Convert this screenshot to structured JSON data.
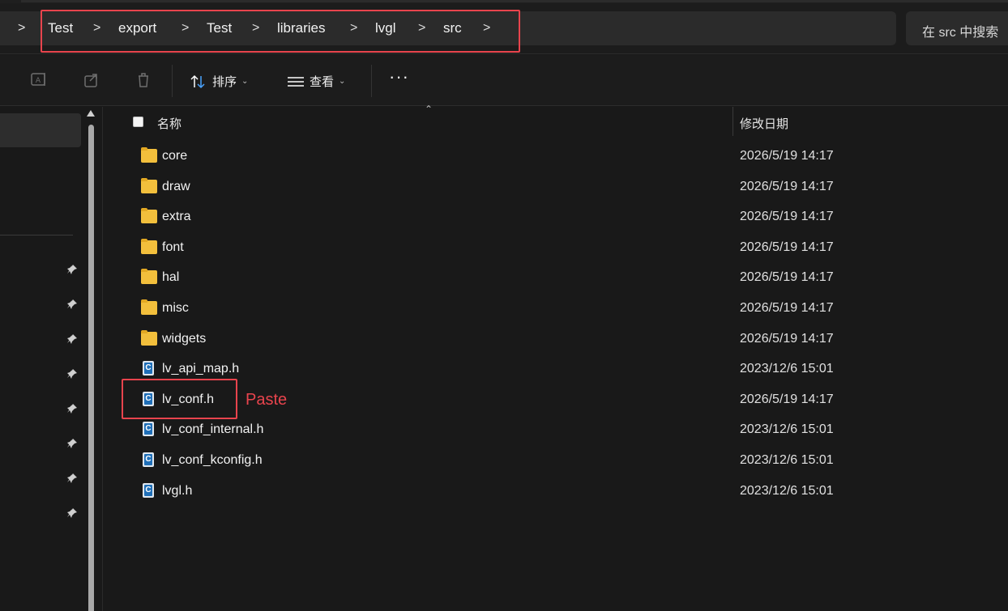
{
  "breadcrumb": {
    "lead_chevron": ">",
    "items": [
      "Test",
      "export",
      "Test",
      "libraries",
      "lvgl",
      "src"
    ],
    "separator": ">"
  },
  "search": {
    "placeholder": "在 src 中搜索"
  },
  "toolbar": {
    "sort_label": "排序",
    "view_label": "查看",
    "more_label": "···",
    "icons": [
      "rename-icon",
      "share-icon",
      "delete-icon"
    ]
  },
  "columns": {
    "name": "名称",
    "date_modified": "修改日期"
  },
  "files": [
    {
      "name": "core",
      "type": "folder",
      "modified": "2026/5/19 14:17"
    },
    {
      "name": "draw",
      "type": "folder",
      "modified": "2026/5/19 14:17"
    },
    {
      "name": "extra",
      "type": "folder",
      "modified": "2026/5/19 14:17"
    },
    {
      "name": "font",
      "type": "folder",
      "modified": "2026/5/19 14:17"
    },
    {
      "name": "hal",
      "type": "folder",
      "modified": "2026/5/19 14:17"
    },
    {
      "name": "misc",
      "type": "folder",
      "modified": "2026/5/19 14:17"
    },
    {
      "name": "widgets",
      "type": "folder",
      "modified": "2026/5/19 14:17"
    },
    {
      "name": "lv_api_map.h",
      "type": "c-header",
      "modified": "2023/12/6 15:01"
    },
    {
      "name": "lv_conf.h",
      "type": "c-header",
      "modified": "2026/5/19 14:17"
    },
    {
      "name": "lv_conf_internal.h",
      "type": "c-header",
      "modified": "2023/12/6 15:01"
    },
    {
      "name": "lv_conf_kconfig.h",
      "type": "c-header",
      "modified": "2023/12/6 15:01"
    },
    {
      "name": "lvgl.h",
      "type": "c-header",
      "modified": "2023/12/6 15:01"
    }
  ],
  "annotation": {
    "label": "Paste",
    "color": "#e8444d"
  },
  "colors": {
    "background": "#191919",
    "folder": "#f2bf3c",
    "highlight": "#e8444d"
  }
}
